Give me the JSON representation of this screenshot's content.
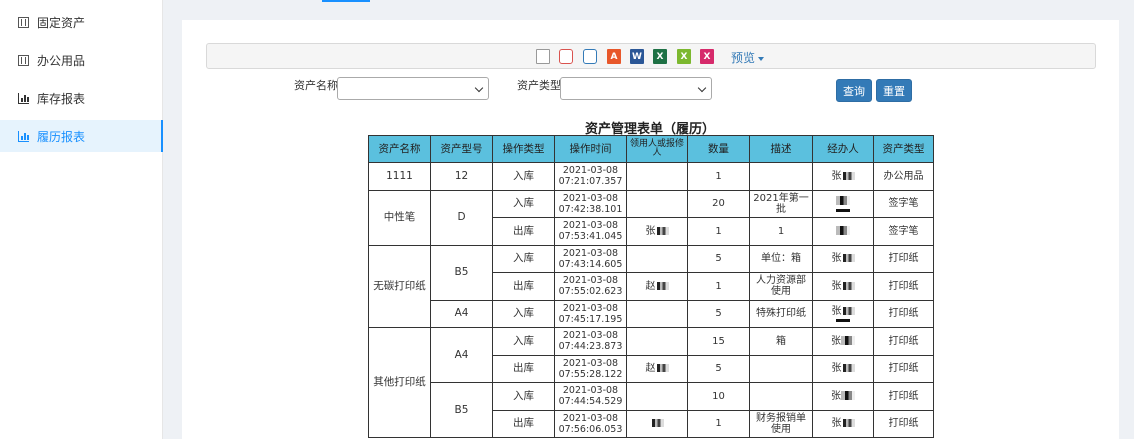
{
  "sidebar": {
    "items": [
      {
        "label": "固定资产",
        "icon": "asset-icon"
      },
      {
        "label": "办公用品",
        "icon": "supplies-icon"
      },
      {
        "label": "库存报表",
        "icon": "bar-chart-icon"
      },
      {
        "label": "履历报表",
        "icon": "bar-chart-icon",
        "active": true
      }
    ]
  },
  "toolbar": {
    "icons": [
      "print-preview-icon",
      "print-icon",
      "print-icon",
      "pdf-icon",
      "word-icon",
      "excel-icon",
      "excel-icon",
      "excel-icon"
    ],
    "preview_label": "预览"
  },
  "filters": {
    "asset_name_label": "资产名称",
    "asset_name_value": "",
    "asset_type_label": "资产类型",
    "asset_type_value": "",
    "query_button": "查询",
    "reset_button": "重置"
  },
  "report": {
    "title": "资产管理表单（履历）",
    "headers": [
      "资产名称",
      "资产型号",
      "操作类型",
      "操作时间",
      "领用人或报修人",
      "数量",
      "描述",
      "经办人",
      "资产类型"
    ],
    "rows": [
      {
        "name": "1111",
        "model": "12",
        "op": "入库",
        "time": "2021-03-08 07:21:07.357",
        "recipient": "",
        "qty": "1",
        "desc": "",
        "handler": "张",
        "type": "办公用品"
      },
      {
        "name": "中性笔",
        "model": "D",
        "op": "入库",
        "time": "2021-03-08 07:42:38.101",
        "recipient": "",
        "qty": "20",
        "desc": "2021年第一批",
        "handler": "",
        "type": "签字笔"
      },
      {
        "name": "",
        "model": "",
        "op": "出库",
        "time": "2021-03-08 07:53:41.045",
        "recipient": "张",
        "qty": "1",
        "desc": "1",
        "handler": "",
        "type": "签字笔"
      },
      {
        "name": "无碳打印纸",
        "model": "B5",
        "op": "入库",
        "time": "2021-03-08 07:43:14.605",
        "recipient": "",
        "qty": "5",
        "desc": "单位：箱",
        "handler": "张",
        "type": "打印纸"
      },
      {
        "name": "",
        "model": "",
        "op": "出库",
        "time": "2021-03-08 07:55:02.623",
        "recipient": "赵",
        "qty": "1",
        "desc": "人力资源部使用",
        "handler": "张",
        "type": "打印纸"
      },
      {
        "name": "",
        "model": "A4",
        "op": "入库",
        "time": "2021-03-08 07:45:17.195",
        "recipient": "",
        "qty": "5",
        "desc": "特殊打印纸",
        "handler": "张",
        "type": "打印纸"
      },
      {
        "name": "其他打印纸",
        "model": "A4",
        "op": "入库",
        "time": "2021-03-08 07:44:23.873",
        "recipient": "",
        "qty": "15",
        "desc": "箱",
        "handler": "张",
        "type": "打印纸"
      },
      {
        "name": "",
        "model": "",
        "op": "出库",
        "time": "2021-03-08 07:55:28.122",
        "recipient": "赵",
        "qty": "5",
        "desc": "",
        "handler": "张",
        "type": "打印纸"
      },
      {
        "name": "",
        "model": "B5",
        "op": "入库",
        "time": "2021-03-08 07:44:54.529",
        "recipient": "",
        "qty": "10",
        "desc": "",
        "handler": "张",
        "type": "打印纸"
      },
      {
        "name": "",
        "model": "",
        "op": "出库",
        "time": "2021-03-08 07:56:06.053",
        "recipient": "",
        "qty": "1",
        "desc": "财务报销单使用",
        "handler": "张",
        "type": "打印纸"
      }
    ]
  }
}
